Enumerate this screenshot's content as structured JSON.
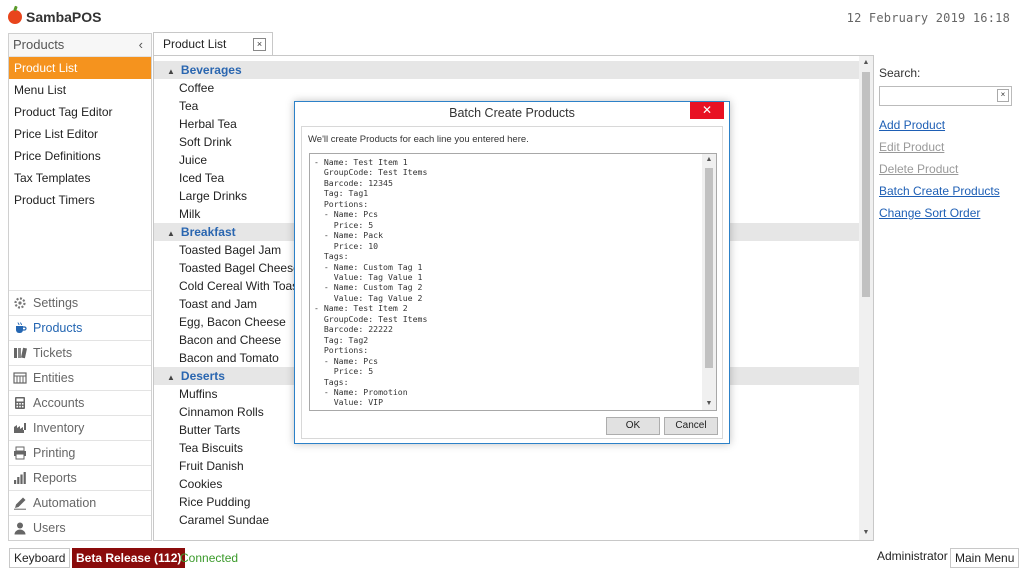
{
  "app": {
    "name": "SambaPOS",
    "datetime": "12 February 2019 16:18"
  },
  "left_nav": {
    "title": "Products",
    "collapse_icon": "‹",
    "items": [
      {
        "label": "Product List",
        "active": true
      },
      {
        "label": "Menu List"
      },
      {
        "label": "Product Tag Editor"
      },
      {
        "label": "Price List Editor"
      },
      {
        "label": "Price Definitions"
      },
      {
        "label": "Tax Templates"
      },
      {
        "label": "Product Timers"
      }
    ],
    "modules": [
      {
        "label": "Settings",
        "icon": "gear-icon"
      },
      {
        "label": "Products",
        "icon": "cup-icon",
        "active": true
      },
      {
        "label": "Tickets",
        "icon": "tickets-icon"
      },
      {
        "label": "Entities",
        "icon": "entities-icon"
      },
      {
        "label": "Accounts",
        "icon": "calculator-icon"
      },
      {
        "label": "Inventory",
        "icon": "inventory-icon"
      },
      {
        "label": "Printing",
        "icon": "printer-icon"
      },
      {
        "label": "Reports",
        "icon": "bar-chart-icon"
      },
      {
        "label": "Automation",
        "icon": "pen-icon"
      },
      {
        "label": "Users",
        "icon": "user-icon"
      }
    ]
  },
  "tab": {
    "label": "Product List",
    "close": "×"
  },
  "groups": [
    {
      "name": "Beverages",
      "items": [
        "Coffee",
        "Tea",
        "Herbal Tea",
        "Soft Drink",
        "Juice",
        "Iced Tea",
        "Large Drinks",
        "Milk"
      ]
    },
    {
      "name": "Breakfast",
      "items": [
        "Toasted Bagel Jam",
        "Toasted Bagel Cheese",
        "Cold Cereal With Toast",
        "Toast and Jam",
        "Egg, Bacon Cheese",
        "Bacon and Cheese",
        "Bacon and Tomato"
      ]
    },
    {
      "name": "Deserts",
      "items": [
        "Muffins",
        "Cinnamon Rolls",
        "Butter Tarts",
        "Tea Biscuits",
        "Fruit Danish",
        "Cookies",
        "Rice Pudding",
        "Caramel Sundae"
      ]
    }
  ],
  "right_panel": {
    "search_label": "Search:",
    "search_value": "",
    "clear": "×",
    "actions": [
      {
        "label": "Add Product",
        "enabled": true
      },
      {
        "label": "Edit Product",
        "enabled": false
      },
      {
        "label": "Delete Product",
        "enabled": false
      },
      {
        "label": "Batch Create Products",
        "enabled": true
      },
      {
        "label": "Change Sort Order",
        "enabled": true
      }
    ]
  },
  "dialog": {
    "title": "Batch Create Products",
    "close": "✕",
    "message": "We'll create Products for each line you entered here.",
    "lines": [
      "- Name: Test Item 1",
      "  GroupCode: Test Items",
      "  Barcode: 12345",
      "  Tag: Tag1",
      "  Portions:",
      "  - Name: Pcs",
      "    Price: 5",
      "  - Name: Pack",
      "    Price: 10",
      "  Tags:",
      "  - Name: Custom Tag 1",
      "    Value: Tag Value 1",
      "  - Name: Custom Tag 2",
      "    Value: Tag Value 2",
      "- Name: Test Item 2",
      "  GroupCode: Test Items",
      "  Barcode: 22222",
      "  Tag: Tag2",
      "  Portions:",
      "  - Name: Pcs",
      "    Price: 5",
      "  Tags:",
      "  - Name: Promotion",
      "    Value: VIP"
    ],
    "ok_label": "OK",
    "cancel_label": "Cancel"
  },
  "footer": {
    "keyboard": "Keyboard",
    "release": "Beta Release (112)",
    "status": "Connected",
    "user": "Administrator",
    "main_menu": "Main Menu"
  }
}
